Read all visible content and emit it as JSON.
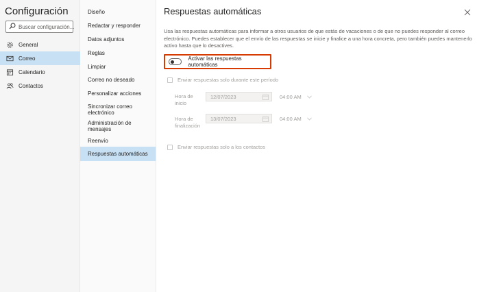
{
  "app": {
    "title": "Configuración"
  },
  "search": {
    "placeholder": "Buscar configuración..."
  },
  "nav": {
    "items": [
      {
        "label": "General",
        "icon": "gear-icon"
      },
      {
        "label": "Correo",
        "icon": "mail-icon",
        "selected": true
      },
      {
        "label": "Calendario",
        "icon": "calendar-icon"
      },
      {
        "label": "Contactos",
        "icon": "people-icon"
      }
    ]
  },
  "submenu": {
    "items": [
      {
        "label": "Diseño"
      },
      {
        "label": "Redactar y responder"
      },
      {
        "label": "Datos adjuntos"
      },
      {
        "label": "Reglas"
      },
      {
        "label": "Limpiar"
      },
      {
        "label": "Correo no deseado"
      },
      {
        "label": "Personalizar acciones"
      },
      {
        "label": "Sincronizar correo electrónico"
      },
      {
        "label": "Administración de mensajes"
      },
      {
        "label": "Reenvío"
      },
      {
        "label": "Respuestas automáticas",
        "selected": true
      }
    ]
  },
  "content": {
    "title": "Respuestas automáticas",
    "description": "Usa las respuestas automáticas para informar a otros usuarios de que estás de vacaciones o de que no puedes responder al correo electrónico. Puedes establecer que el envío de las respuestas se inicie y finalice a una hora concreta, pero también puedes mantenerlo activo hasta que lo desactives.",
    "toggle_label": "Activar las respuestas automáticas",
    "toggle_on": false,
    "period_checkbox": "Enviar respuestas solo durante este período",
    "start_label": "Hora de inicio",
    "start_date": "12/07/2023",
    "start_time": "04:00 AM",
    "end_label": "Hora de finalización",
    "end_date": "13/07/2023",
    "end_time": "04:00 AM",
    "contacts_checkbox": "Enviar respuestas solo a los contactos"
  },
  "colors": {
    "selected_bg": "#c7e0f4",
    "highlight_border": "#d83b01",
    "left_pane_bg": "#f5f5f5"
  }
}
